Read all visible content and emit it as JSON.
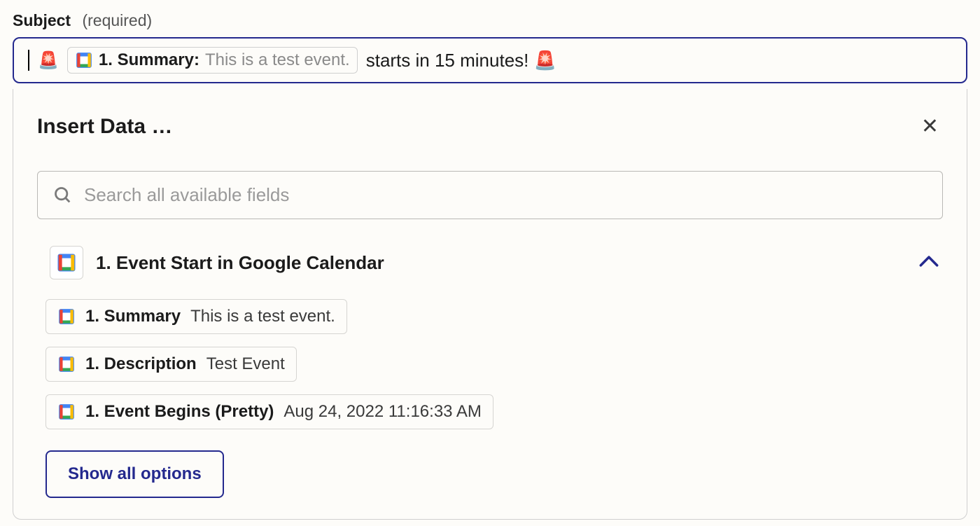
{
  "field": {
    "label": "Subject",
    "required_text": "(required)"
  },
  "subject": {
    "prefix_emoji": "🚨",
    "chip": {
      "key": "1. Summary:",
      "value": "This is a test event."
    },
    "suffix_text": "starts in 15 minutes! 🚨"
  },
  "panel": {
    "title": "Insert Data …",
    "search_placeholder": "Search all available fields",
    "group": {
      "title": "1. Event Start in Google Calendar",
      "expanded": true,
      "options": [
        {
          "key": "1. Summary",
          "value": "This is a test event."
        },
        {
          "key": "1. Description",
          "value": "Test Event"
        },
        {
          "key": "1. Event Begins (Pretty)",
          "value": "Aug 24, 2022 11:16:33 AM"
        }
      ]
    },
    "show_all_label": "Show all options"
  }
}
